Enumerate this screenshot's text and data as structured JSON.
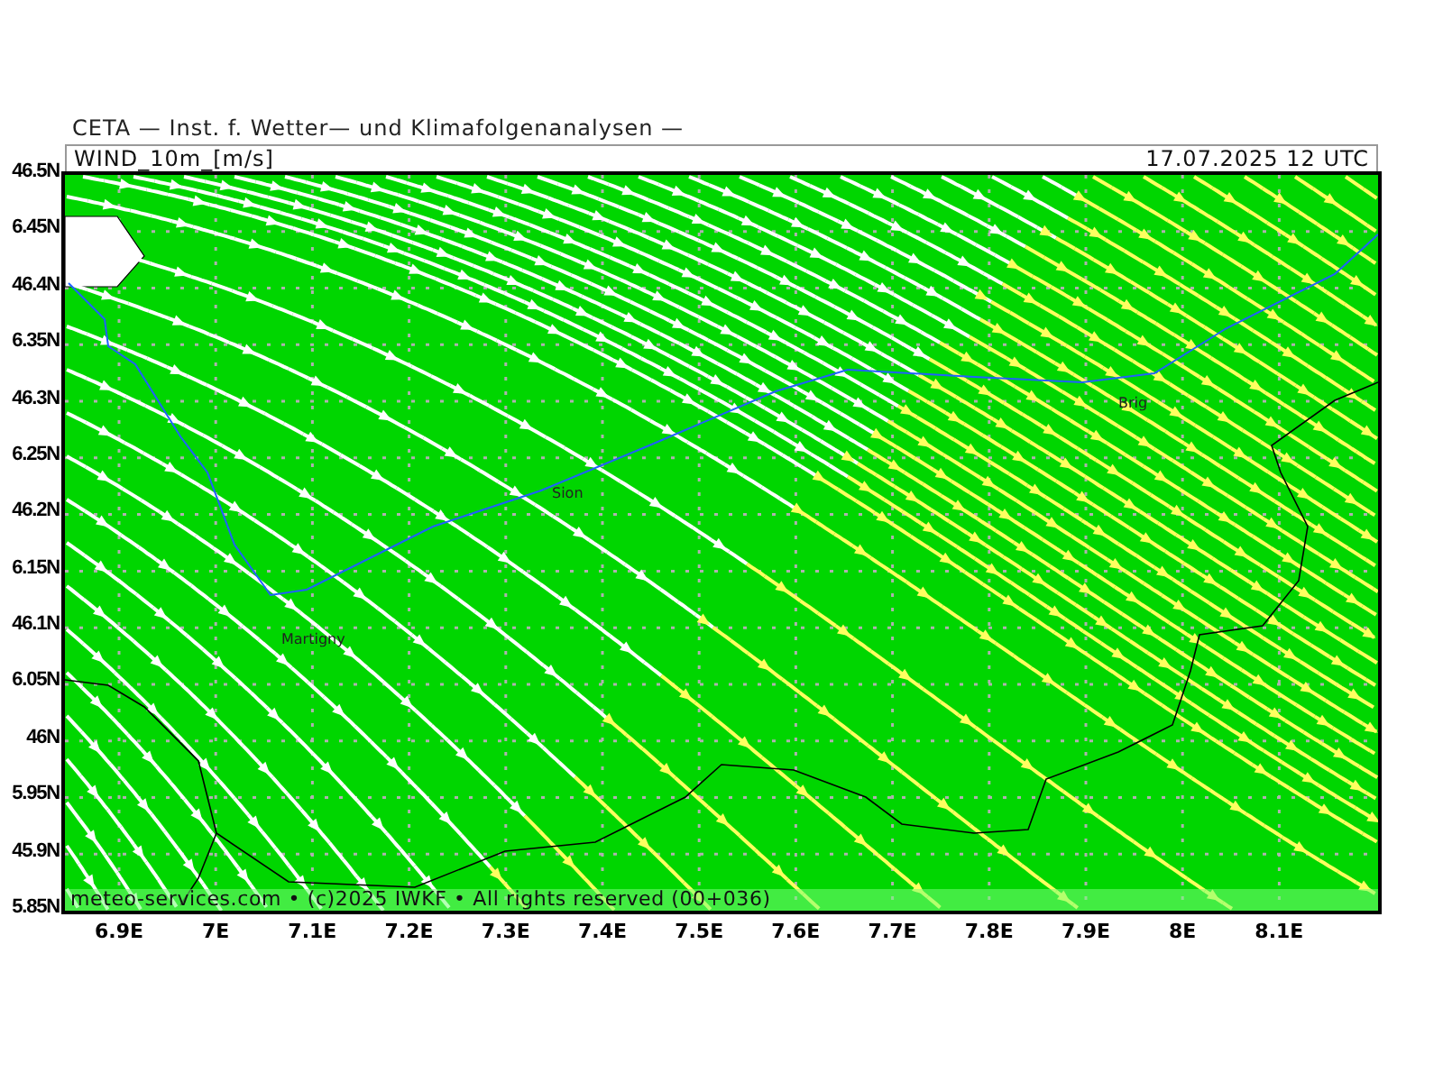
{
  "header": {
    "institution": "CETA — Inst. f. Wetter— und Klimafolgenanalysen —"
  },
  "map": {
    "variable": "WIND_10m_[m/s]",
    "valid_time": "17.07.2025 12 UTC",
    "places": [
      "Sion",
      "Martigny",
      "Brig"
    ],
    "footer": "meteo-services.com • (c)2025 IWKF • All rights reserved (00+036)",
    "lat_labels": [
      "46.5N",
      "6.45N",
      "46.4N",
      "6.35N",
      "46.3N",
      "6.25N",
      "46.2N",
      "6.15N",
      "46.1N",
      "6.05N",
      "46N",
      "5.95N",
      "45.9N",
      "5.85N"
    ],
    "lon_labels": [
      "6.9E",
      "7E",
      "7.1E",
      "7.2E",
      "7.3E",
      "7.4E",
      "7.5E",
      "7.6E",
      "7.7E",
      "7.8E",
      "7.9E",
      "8E",
      "8.1E"
    ]
  }
}
